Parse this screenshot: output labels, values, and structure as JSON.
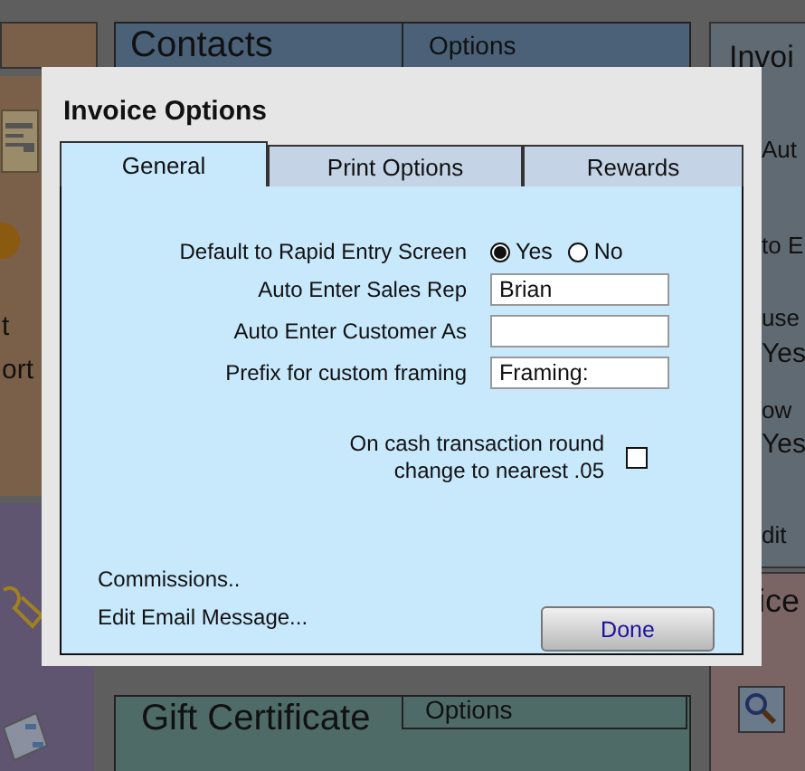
{
  "backdrop": {
    "contacts_panel": {
      "title": "Contacts",
      "menu": "Options"
    },
    "gift_panel": {
      "title": "Gift Certificate",
      "menu": "Options"
    },
    "invoice_panel": {
      "title": "Invoi",
      "lines": [
        "Aut",
        "to E",
        "use",
        "Yes",
        "ow",
        "Yes",
        "dit"
      ]
    },
    "price_panel": {
      "title": "ice"
    },
    "left_panel": {
      "lines": [
        "t",
        "ort"
      ]
    }
  },
  "dialog": {
    "title": "Invoice Options",
    "tabs": [
      {
        "label": "General",
        "selected": true
      },
      {
        "label": "Print Options",
        "selected": false
      },
      {
        "label": "Rewards",
        "selected": false
      }
    ],
    "settings": [
      {
        "kind": "radio",
        "label": "Default to Rapid Entry Screen",
        "options": [
          {
            "label": "Yes",
            "selected": true
          },
          {
            "label": "No",
            "selected": false
          }
        ]
      },
      {
        "kind": "text",
        "label": "Auto Enter Sales Rep",
        "value": "Brian"
      },
      {
        "kind": "text",
        "label": "Auto Enter Customer As"
      },
      {
        "kind": "text",
        "label": "Prefix for custom framing",
        "value": "Framing:"
      },
      {
        "kind": "checkbox",
        "label": "On cash transaction round change to nearest .05",
        "checked": false
      }
    ],
    "links": [
      "Commissions..",
      "Edit Email Message..."
    ],
    "done_button": "Done"
  }
}
